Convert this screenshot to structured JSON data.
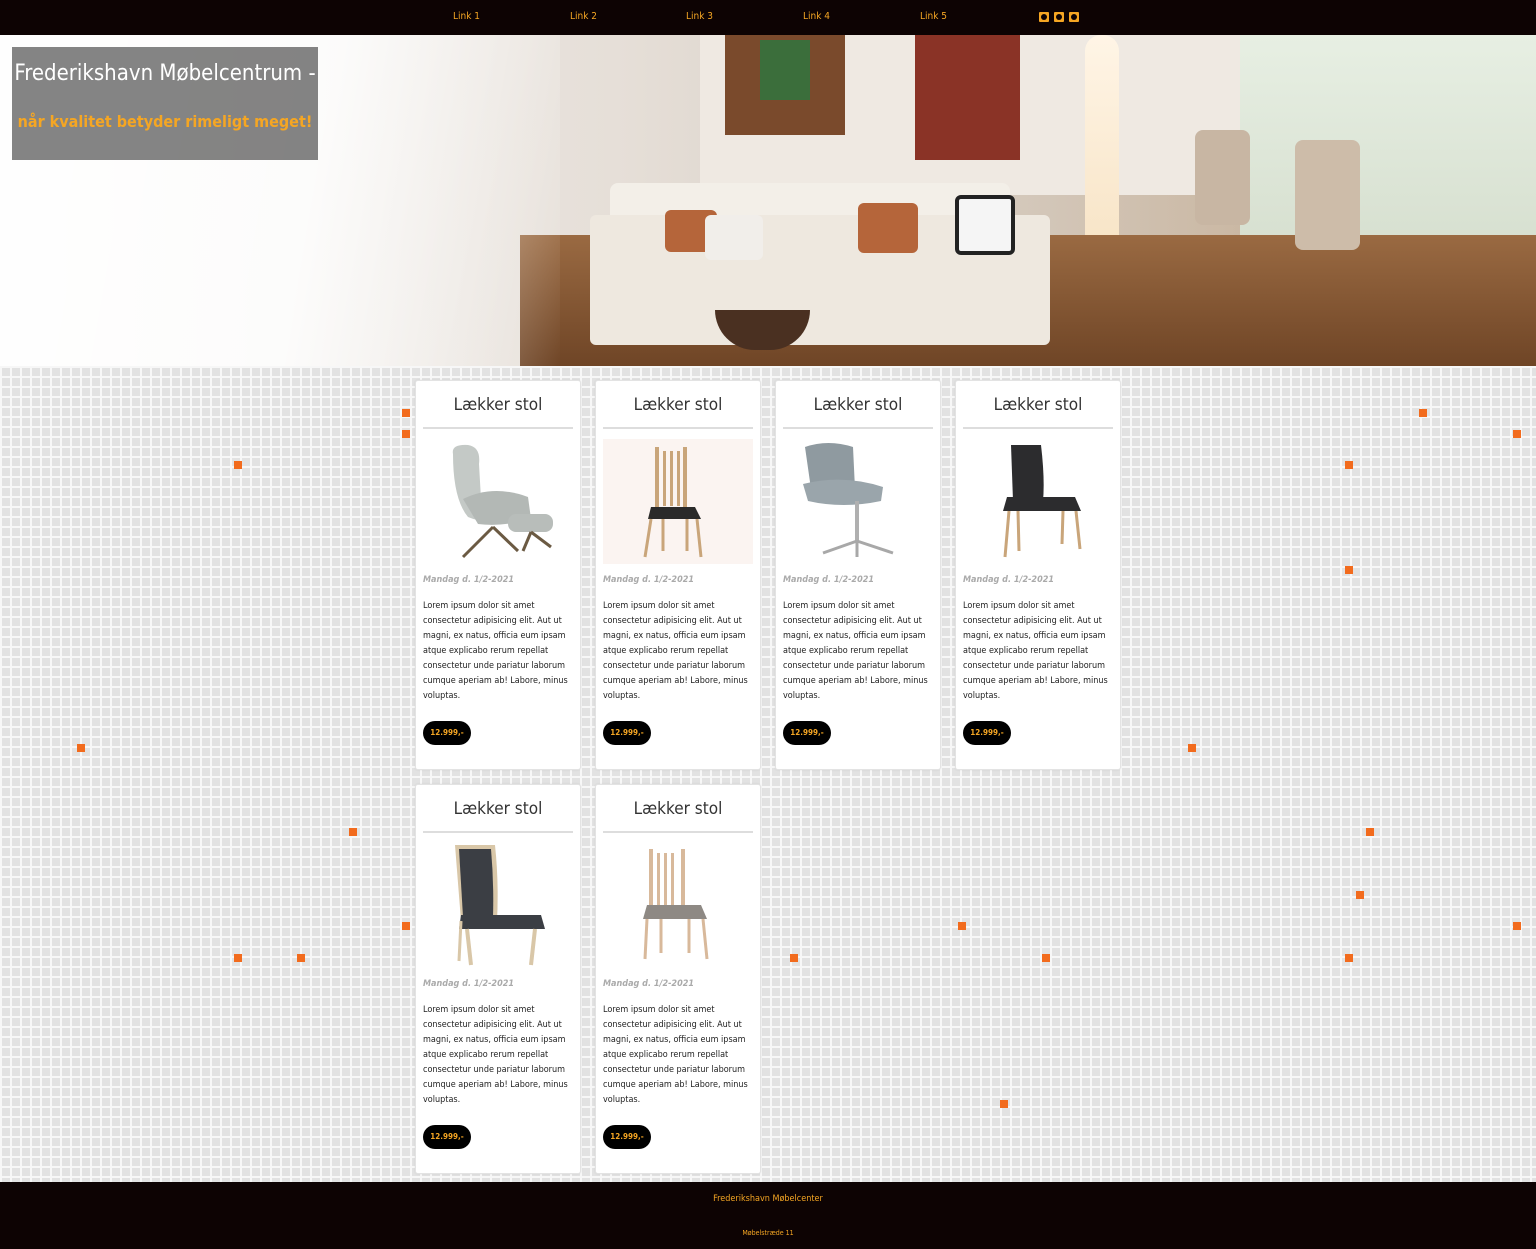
{
  "nav": {
    "links": [
      "Link 1",
      "Link 2",
      "Link 3",
      "Link 4",
      "Link 5"
    ],
    "social_icons": [
      "twitter-icon",
      "facebook-icon",
      "instagram-icon"
    ],
    "accent_color": "#f5a623",
    "background_color": "#0d0303"
  },
  "hero": {
    "title": "Frederikshavn Møbelcentrum -",
    "subtitle": "når kvalitet betyder rimeligt meget!"
  },
  "products": [
    {
      "title": "Lækker stol",
      "date": "Mandag d. 1/2-2021",
      "description": "Lorem ipsum dolor sit amet consectetur adipisicing elit. Aut ut magni, ex natus, officia eum ipsam atque explicabo rerum repellat consectetur unde pariatur laborum cumque aperiam ab! Labore, minus voluptas.",
      "price": "12.999,-",
      "image": "lounge-chair-with-ottoman"
    },
    {
      "title": "Lækker stol",
      "date": "Mandag d. 1/2-2021",
      "description": "Lorem ipsum dolor sit amet consectetur adipisicing elit. Aut ut magni, ex natus, officia eum ipsam atque explicabo rerum repellat consectetur unde pariatur laborum cumque aperiam ab! Labore, minus voluptas.",
      "price": "12.999,-",
      "image": "wooden-spindle-chair"
    },
    {
      "title": "Lækker stol",
      "date": "Mandag d. 1/2-2021",
      "description": "Lorem ipsum dolor sit amet consectetur adipisicing elit. Aut ut magni, ex natus, officia eum ipsam atque explicabo rerum repellat consectetur unde pariatur laborum cumque aperiam ab! Labore, minus voluptas.",
      "price": "12.999,-",
      "image": "swivel-armchair"
    },
    {
      "title": "Lækker stol",
      "date": "Mandag d. 1/2-2021",
      "description": "Lorem ipsum dolor sit amet consectetur adipisicing elit. Aut ut magni, ex natus, officia eum ipsam atque explicabo rerum repellat consectetur unde pariatur laborum cumque aperiam ab! Labore, minus voluptas.",
      "price": "12.999,-",
      "image": "black-upholstered-chair"
    },
    {
      "title": "Lækker stol",
      "date": "Mandag d. 1/2-2021",
      "description": "Lorem ipsum dolor sit amet consectetur adipisicing elit. Aut ut magni, ex natus, officia eum ipsam atque explicabo rerum repellat consectetur unde pariatur laborum cumque aperiam ab! Labore, minus voluptas.",
      "price": "12.999,-",
      "image": "grey-upholstered-chair"
    },
    {
      "title": "Lækker stol",
      "date": "Mandag d. 1/2-2021",
      "description": "Lorem ipsum dolor sit amet consectetur adipisicing elit. Aut ut magni, ex natus, officia eum ipsam atque explicabo rerum repellat consectetur unde pariatur laborum cumque aperiam ab! Labore, minus voluptas.",
      "price": "12.999,-",
      "image": "wooden-chair-grey-seat"
    }
  ],
  "footer": {
    "company": "Frederikshavn Møbelcenter",
    "address": "Møbelstræde 11"
  }
}
